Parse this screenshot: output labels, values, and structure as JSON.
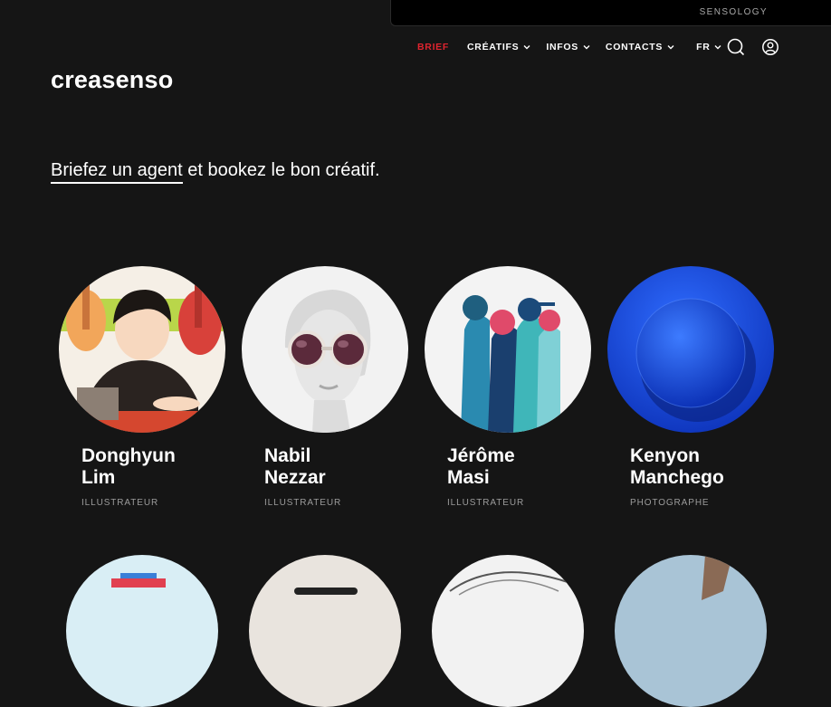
{
  "topbar": {
    "label": "SENSOLOGY"
  },
  "nav": {
    "items": [
      {
        "label": "BRIEF",
        "color": "#e0242f",
        "dropdown": false
      },
      {
        "label": "CRÉATIFS",
        "dropdown": true
      },
      {
        "label": "INFOS",
        "dropdown": true
      },
      {
        "label": "CONTACTS",
        "dropdown": true
      },
      {
        "label": "FR",
        "dropdown": true
      }
    ],
    "icons": [
      "search-icon",
      "user-account-icon"
    ]
  },
  "logo": {
    "text": "creasenso"
  },
  "hero": {
    "link_text": "Briefez un agent",
    "rest_text": " et bookez le bon créatif."
  },
  "creatives": [
    {
      "name": "Donghyun\nLim",
      "role": "ILLUSTRATEUR"
    },
    {
      "name": "Nabil\nNezzar",
      "role": "ILLUSTRATEUR"
    },
    {
      "name": "Jérôme\nMasi",
      "role": "ILLUSTRATEUR"
    },
    {
      "name": "Kenyon\nManchego",
      "role": "PHOTOGRAPHE"
    }
  ],
  "colors": {
    "background": "#151515",
    "accent": "#e0242f",
    "muted": "#9c9c9c"
  }
}
